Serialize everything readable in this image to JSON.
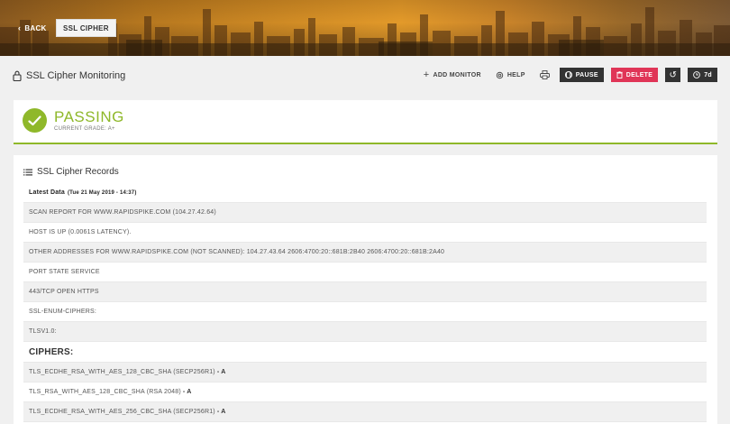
{
  "hero": {
    "back_label": "BACK",
    "crumb_label": "SSL CIPHER"
  },
  "header": {
    "title": "SSL Cipher Monitoring",
    "actions": {
      "add_monitor": "ADD MONITOR",
      "help": "HELP",
      "pause": "PAUSE",
      "delete": "DELETE",
      "period": "7d"
    }
  },
  "status": {
    "title": "PASSING",
    "subtitle": "CURRENT GRADE: A+",
    "color": "#8fb82a"
  },
  "records": {
    "title": "SSL Cipher Records",
    "latest_label": "Latest Data",
    "latest_timestamp": "(Tue 21 May 2019 - 14:37)",
    "rows": [
      "SCAN REPORT FOR WWW.RAPIDSPIKE.COM (104.27.42.64)",
      "HOST IS UP (0.0061S LATENCY).",
      "OTHER ADDRESSES FOR WWW.RAPIDSPIKE.COM (NOT SCANNED): 104.27.43.64 2606:4700:20::681B:2B40 2606:4700:20::681B:2A40",
      "PORT STATE SERVICE",
      "443/TCP OPEN HTTPS",
      "SSL-ENUM-CIPHERS:",
      "TLSV1.0:"
    ],
    "ciphers_heading": "CIPHERS:",
    "ciphers": [
      {
        "name": "TLS_ECDHE_RSA_WITH_AES_128_CBC_SHA (SECP256R1)",
        "grade": "- A"
      },
      {
        "name": "TLS_RSA_WITH_AES_128_CBC_SHA (RSA 2048)",
        "grade": "- A"
      },
      {
        "name": "TLS_ECDHE_RSA_WITH_AES_256_CBC_SHA (SECP256R1)",
        "grade": "- A"
      }
    ]
  },
  "colors": {
    "accent_green": "#8fb82a",
    "delete_red": "#e03557",
    "dark_button": "#333333"
  }
}
